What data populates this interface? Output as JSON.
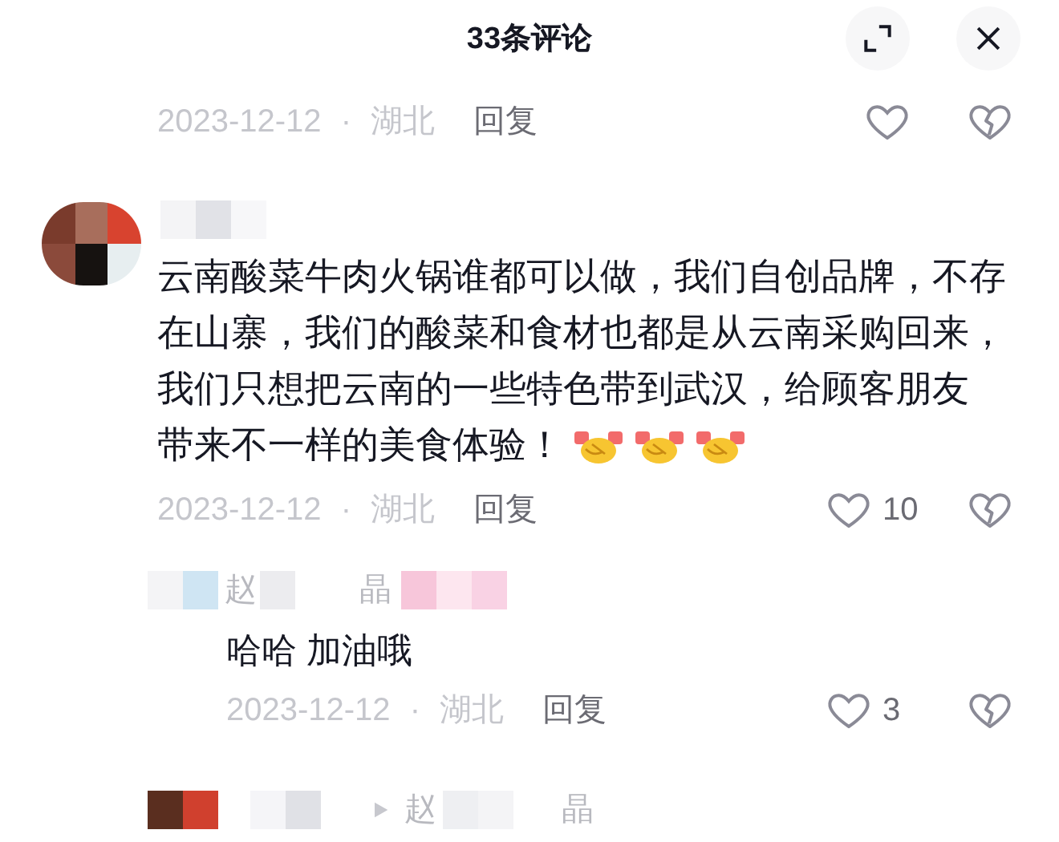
{
  "header": {
    "title": "33条评论"
  },
  "comments": [
    {
      "kind": "cut",
      "meta": {
        "date": "2023-12-12",
        "separator": "·",
        "location": "湖北",
        "reply": "回复"
      }
    },
    {
      "kind": "comment",
      "lines": [
        "云南酸菜牛肉火锅谁都可以做，我们自创品牌，不存",
        "在山寨，我们的酸菜和食材也都是从云南采购回来，",
        "我们只想把云南的一些特色带到武汉，给顾客朋友",
        "带来不一样的美食体验！"
      ],
      "emojis": [
        {
          "kind": "handshake"
        },
        {
          "kind": "handshake"
        },
        {
          "kind": "handshake"
        }
      ],
      "meta": {
        "date": "2023-12-12",
        "separator": "·",
        "location": "湖北",
        "reply": "回复"
      },
      "likes": "10"
    },
    {
      "kind": "reply",
      "name_parts": [
        "赵",
        "晶"
      ],
      "lines": [
        "哈哈 加油哦"
      ],
      "meta": {
        "date": "2023-12-12",
        "separator": "·",
        "location": "湖北",
        "reply": "回复"
      },
      "likes": "3"
    },
    {
      "kind": "reply_to",
      "name_parts": [
        "赵",
        "晶"
      ]
    }
  ]
}
